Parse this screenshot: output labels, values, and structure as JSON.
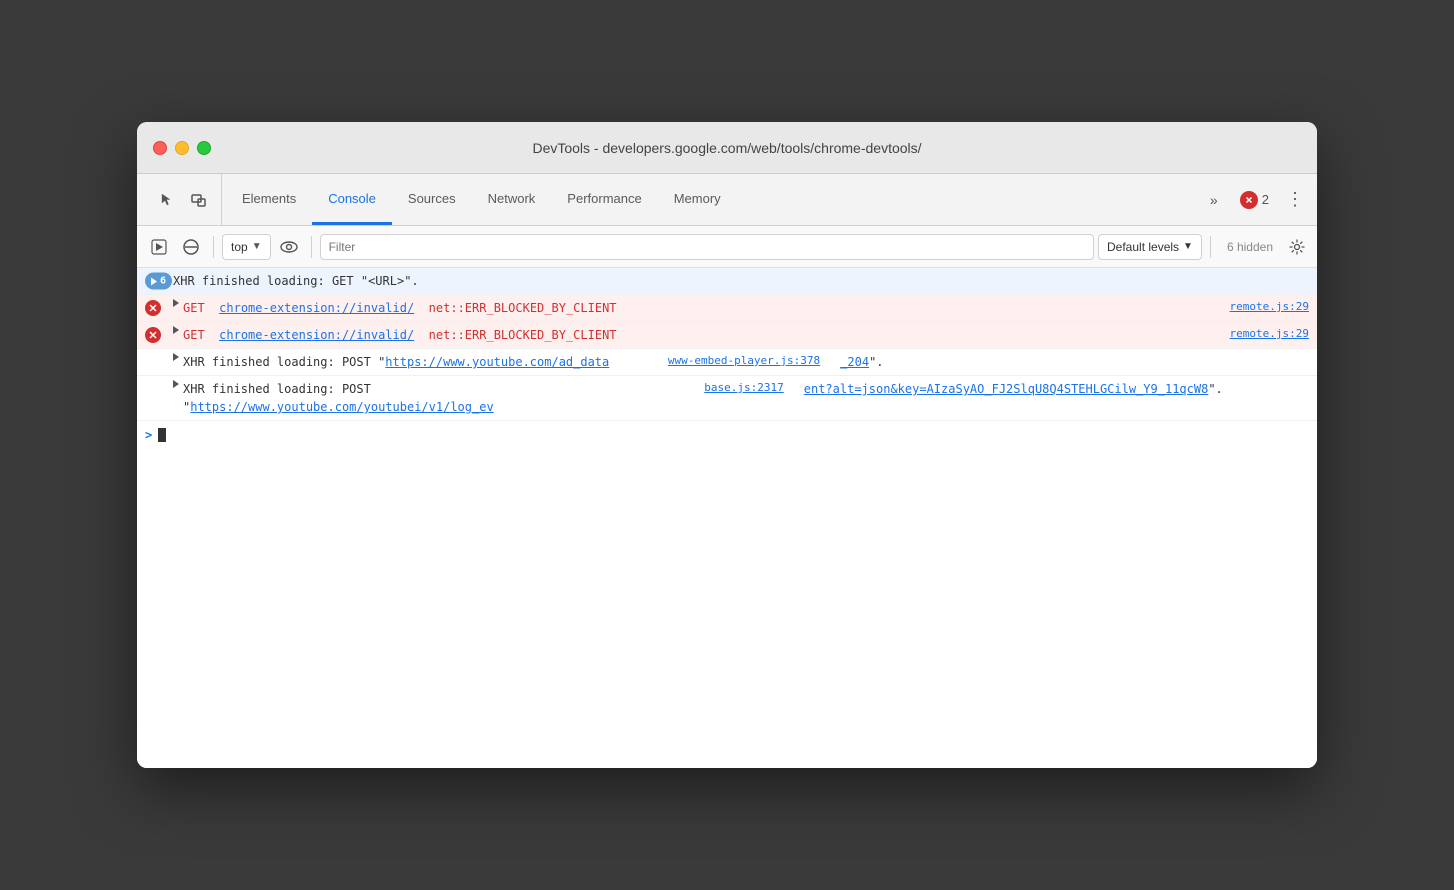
{
  "window": {
    "title": "DevTools - developers.google.com/web/tools/chrome-devtools/"
  },
  "tabs": [
    {
      "id": "elements",
      "label": "Elements",
      "active": false
    },
    {
      "id": "console",
      "label": "Console",
      "active": true
    },
    {
      "id": "sources",
      "label": "Sources",
      "active": false
    },
    {
      "id": "network",
      "label": "Network",
      "active": false
    },
    {
      "id": "performance",
      "label": "Performance",
      "active": false
    },
    {
      "id": "memory",
      "label": "Memory",
      "active": false
    }
  ],
  "error_badge": {
    "count": "2"
  },
  "console_toolbar": {
    "context": "top",
    "filter_placeholder": "Filter",
    "levels_label": "Default levels",
    "hidden_count": "6 hidden"
  },
  "log_entries": [
    {
      "type": "info",
      "count": "6",
      "text": "XHR finished loading: GET \"<URL>\"."
    },
    {
      "type": "error",
      "method": "GET",
      "url": "chrome-extension://invalid/",
      "error_text": "net::ERR_BLOCKED_BY_CLIENT",
      "source": "remote.js:29"
    },
    {
      "type": "error",
      "method": "GET",
      "url": "chrome-extension://invalid/",
      "error_text": "net::ERR_BLOCKED_BY_CLIENT",
      "source": "remote.js:29"
    },
    {
      "type": "log",
      "text_prefix": "XHR finished loading: POST \"",
      "url": "https://www.youtube.com/ad_data",
      "text_suffix": "",
      "source": "www-embed-player.js:378",
      "source2": "_204",
      "text_after": "\"."
    },
    {
      "type": "log2",
      "text_prefix": "XHR finished loading: POST \"",
      "url": "https://www.youtube.com/youtubei/v1/log_ev",
      "source": "base.js:2317",
      "text_cont": "ent?alt=json&key=AIzaSyAO_FJ2SlqU8Q4STEHLGCilw_Y9_11qcW8\"."
    }
  ]
}
